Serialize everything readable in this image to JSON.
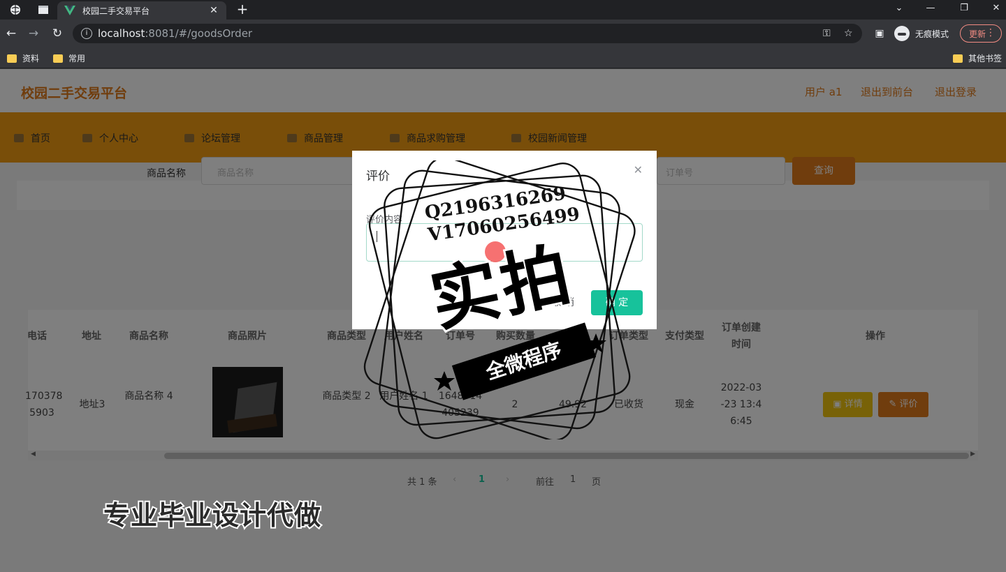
{
  "browser": {
    "tab_title": "校园二手交易平台",
    "url_host": "localhost",
    "url_rest": ":8081/#/goodsOrder",
    "incognito_label": "无痕模式",
    "update_label": "更新",
    "bookmarks": [
      "资料",
      "常用"
    ],
    "other_bookmarks": "其他书签"
  },
  "app": {
    "brand": "校园二手交易平台",
    "user_label": "用户 a1",
    "back_label": "退出到前台",
    "logout_label": "退出登录",
    "menu": [
      "首页",
      "个人中心",
      "论坛管理",
      "商品管理",
      "商品求购管理",
      "校园新闻管理"
    ]
  },
  "search": {
    "label": "商品名称",
    "placeholder": "商品名称",
    "placeholder2": "订单号",
    "query_label": "查询"
  },
  "table": {
    "headers": [
      "电话",
      "地址",
      "商品名称",
      "商品照片",
      "商品类型",
      "用户姓名",
      "订单号",
      "购买数量",
      "价格",
      "订单类型",
      "支付类型",
      "订单创建时间",
      "操作"
    ],
    "row": {
      "phone": "170378 5903",
      "address": "地址3",
      "goods_name": "商品名称 4",
      "goods_type": "商品类型 2",
      "user_name": "用户姓名 1",
      "order_no": "1648014 405239",
      "quantity": "2",
      "price": "49.92",
      "order_type": "已收货",
      "pay_type": "现金",
      "created": "2022-03-23 13:46:45",
      "detail_label": "详情",
      "review_label": "评价"
    }
  },
  "pagination": {
    "total": "共 1 条",
    "page": "1",
    "goto": "前往",
    "goto_page": "1",
    "page_unit": "页"
  },
  "dialog": {
    "title": "评价",
    "field_label": "评价内容",
    "cancel_label": "取 消",
    "ok_label": "确 定"
  },
  "watermark": {
    "q_line": "Q2196316269",
    "v_line": "V17060256499",
    "big_text": "实拍",
    "banner_text": "全微程序",
    "promo_text": "专业毕业设计代做"
  }
}
